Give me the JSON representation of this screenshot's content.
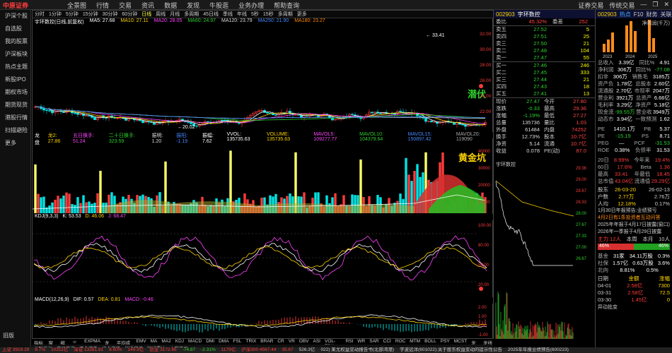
{
  "titlebar": {
    "logo": "中原证券",
    "menus": [
      "全景图",
      "行情",
      "交易",
      "资讯",
      "数据",
      "发现",
      "牛股逛",
      "业务办理",
      "帮助查询"
    ],
    "right": [
      "证券交易",
      "传统交易",
      "—",
      "❐",
      "✕"
    ]
  },
  "leftnav": [
    "沪深个股",
    "自选股",
    "我的股票",
    "沪深板块",
    "热点主题",
    "新股IPO",
    "期权市场",
    "期货现货",
    "港股行情",
    "扫描避险",
    "更多"
  ],
  "leftnav_bottom": "旧版",
  "period": {
    "items": [
      "分时",
      "1分钟",
      "5分钟",
      "15分钟",
      "30分钟",
      "60分钟",
      "日线",
      "周线",
      "月线",
      "多周期",
      "45日线",
      "季线",
      "年线",
      "5秒",
      "15秒",
      "多周期",
      "更多"
    ],
    "active": "日线"
  },
  "stock": {
    "name": "宇环数控(日线,前复权)",
    "ma": [
      "MA5: 27.68",
      "MA10: 27.11",
      "MA20: 28.05",
      "MA60: 24.97",
      "MA120: 23.79",
      "MA250: 21.90",
      "MA180: 23.27"
    ]
  },
  "main": {
    "high": "33.41",
    "low": "20.02",
    "label": "潜伏",
    "yaxis": [
      "32.00",
      "30.00",
      "28.00",
      "26.00",
      "24.00",
      "22.00"
    ]
  },
  "vol": {
    "hdr": [
      "龙盘",
      "龙2: 27.86",
      "五日换手: 51.24",
      "二十日换手: 323.59",
      "振明: 1.20",
      "振阳: -1.19",
      "振幅: 7.62",
      "VVOL: 135735.63",
      "VOLUME: 135735.63",
      "MAVOL5: 109277.77",
      "MAVOL10: 104379.64",
      "MAVOL15: 150897.42",
      "MAVOL20: 119090"
    ],
    "label": "黄金坑",
    "yaxis": [
      "40000",
      "30000",
      "20000",
      "10000"
    ]
  },
  "kdj": {
    "hdr": [
      "KDJ(9,3,3)",
      "K: 53.53",
      "D: 46.06",
      "J: 68.47"
    ],
    "yaxis": [
      "100.00",
      "80.00",
      "50.00",
      "20.00"
    ]
  },
  "macd": {
    "hdr": [
      "MACD(12,26,9)",
      "DIF: 0.57",
      "DEA: 0.81",
      "MACD: -0.46"
    ],
    "yaxis": [
      "2.00",
      "1.00",
      "0.00",
      "-1.00"
    ]
  },
  "bottomtabs": [
    "指标A",
    "窗口",
    "缩略",
    "三线",
    "EXPMA",
    "龙盘",
    "平均成本",
    "EMV",
    "MA",
    "MA2",
    "KDJ",
    "MACD",
    "DMI",
    "DMA",
    "FSL",
    "TRIX",
    "BRAR",
    "CR",
    "VR",
    "OBV",
    "ASI",
    "VOL-TDX",
    "RSI",
    "WR",
    "SAR",
    "CCI",
    "ROC",
    "MTM",
    "BOLL",
    "PSY",
    "MCST",
    "龙线",
    "龙线2"
  ],
  "bottomtabs2": [
    "关联指标",
    "交易查询",
    "资金流向",
    "综合资讯",
    "板块资讯",
    "短线雷达",
    "大宗交易"
  ],
  "orderbook": {
    "code": "002903",
    "name": "宇环数控",
    "weibi_label": "委比",
    "weibi": "45.32%",
    "weicha_label": "委差",
    "weicha": "252",
    "asks": [
      [
        "卖五",
        "27.52",
        "5"
      ],
      [
        "卖四",
        "27.51",
        "25"
      ],
      [
        "卖三",
        "27.50",
        "21"
      ],
      [
        "卖二",
        "27.48",
        "104"
      ],
      [
        "卖一",
        "27.47",
        "55"
      ]
    ],
    "bids": [
      [
        "买一",
        "27.46",
        "246"
      ],
      [
        "买二",
        "27.45",
        "333"
      ],
      [
        "买三",
        "27.44",
        "21"
      ],
      [
        "买四",
        "27.43",
        "18"
      ],
      [
        "买五",
        "27.41",
        "13"
      ]
    ],
    "stats": [
      [
        "现价",
        "27.47",
        "今开",
        "27.80"
      ],
      [
        "涨跌",
        "-0.33",
        "最高",
        "29.36"
      ],
      [
        "涨幅",
        "-1.19%",
        "最低",
        "27.27"
      ],
      [
        "总量",
        "135736",
        "量比",
        "1.03"
      ],
      [
        "外盘",
        "61484",
        "内盘",
        "74252"
      ],
      [
        "换手",
        "12.73%",
        "股本",
        "10.7亿"
      ],
      [
        "净资",
        "5.14",
        "流通",
        "10.7亿"
      ],
      [
        "收益",
        "0.078",
        "PE(动)",
        "87.0"
      ]
    ],
    "intraday_label": "宇环数控",
    "intraday_yaxis": [
      "29.36",
      "29.00",
      "28.67",
      "28.33",
      "28.00",
      "27.67",
      "27.33",
      "27.00",
      "26.67"
    ]
  },
  "right": {
    "code": "002903",
    "tabs": [
      "热点",
      "F10",
      "财务",
      "关联"
    ],
    "rev_label": "净利润(千万)",
    "years": [
      "2023",
      "2024",
      "2025"
    ],
    "rows": [
      [
        "总收入",
        "3.39亿",
        "同比%",
        "4.91"
      ],
      [
        "净利润",
        "306万",
        "同比%",
        "-77.08"
      ],
      [
        "扣非",
        "306万",
        "销售毛",
        "3185万"
      ],
      [
        "资产负",
        "1.78亿",
        "总股本",
        "2.60亿"
      ],
      [
        "流通股",
        "2.70亿",
        "市现率",
        "2047万"
      ],
      [
        "营业利",
        "3921万",
        "总资产",
        "6.66亿"
      ],
      [
        "毛利率",
        "3.29亿",
        "净资产",
        "5.18亿"
      ],
      [
        "现金流",
        "-99.55万",
        "营业收",
        "3949万"
      ],
      [
        "动态市",
        "3.94亿",
        "一致预测",
        "1.62"
      ]
    ],
    "pe_rows": [
      [
        "PE",
        "1410.1万",
        "PB",
        "5.37"
      ],
      [
        "PE",
        "-15.19",
        "PS",
        "8.71"
      ],
      [
        "PEG",
        "—",
        "PCF",
        "-31.53"
      ],
      [
        "ROE",
        "0.38%",
        "负债率",
        "31.53"
      ]
    ],
    "perf": [
      [
        "20日",
        "8.99%",
        "今年来",
        "19.4%"
      ],
      [
        "60日",
        "17.6%",
        "Beta",
        "1.36"
      ],
      [
        "最高",
        "33.41",
        "年最低",
        "18.45"
      ],
      [
        "总市值",
        "43.04亿",
        "流通值",
        "29.29亿"
      ]
    ],
    "events": [
      [
        "股东",
        "26-03-20",
        "",
        "26-02-13"
      ],
      [
        "户数",
        "2.77万",
        "",
        "2.76万"
      ],
      [
        "人均",
        "12.18%",
        "",
        "0.17%"
      ]
    ],
    "news": [
      "1月30日年报预告:业绩预亏",
      "4月2日有1条投资者互动问答",
      "2025年年报于4月17日披露(窗口)",
      "2026年一季报于4月29日披露"
    ],
    "fund": [
      "主力:12人",
      "本周",
      "本月",
      "10人"
    ],
    "fundbar": {
      "left": "46%",
      "right": "46%"
    },
    "basics": [
      [
        "基金",
        "31家",
        "34.11万股",
        "0.3%"
      ],
      [
        "社保",
        "1.57亿",
        "0.63万股",
        "3.6%"
      ],
      [
        "北向",
        "8.81%",
        "0.5%",
        ""
      ]
    ],
    "trades": [
      [
        "日期",
        "金额",
        "涨幅"
      ],
      [
        "04-01",
        "2.58亿",
        "7300"
      ],
      [
        "03-31",
        "2.58亿",
        "72.5"
      ],
      [
        "03-30",
        "1.45亿",
        "0"
      ]
    ],
    "trade_tail": "异动批变"
  },
  "statusbar": [
    "上证 3919.29",
    "8.7%",
    "10311亿",
    "深证 13281.91",
    "8.60%",
    "149.9亿",
    "创业 3172.65",
    "-74.87",
    "-2.31%",
    "1179亿",
    "沪深300 4567.44",
    "35.67",
    "526.3亿",
    "022) 莱尤权益变动报告书(北部湾港)",
    "宇波远洋(601022):关于股东权益变动的提示性公告",
    "2025年年报业绩预告(600223)"
  ]
}
